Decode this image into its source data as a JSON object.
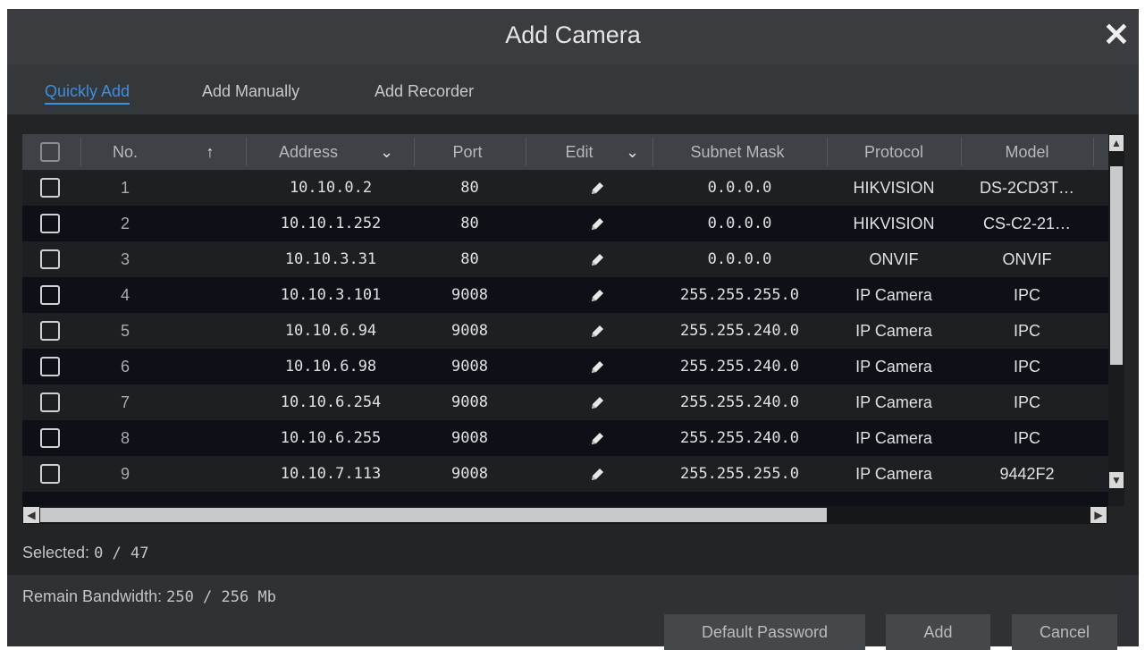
{
  "dialog": {
    "title": "Add Camera"
  },
  "tabs": [
    {
      "label": "Quickly Add",
      "active": true
    },
    {
      "label": "Add Manually",
      "active": false
    },
    {
      "label": "Add Recorder",
      "active": false
    }
  ],
  "table": {
    "headers": {
      "no": "No.",
      "address": "Address",
      "port": "Port",
      "edit": "Edit",
      "subnet": "Subnet Mask",
      "protocol": "Protocol",
      "model": "Model"
    },
    "rows": [
      {
        "no": "1",
        "address": "10.10.0.2",
        "port": "80",
        "subnet": "0.0.0.0",
        "protocol": "HIKVISION",
        "model": "DS-2CD3T…"
      },
      {
        "no": "2",
        "address": "10.10.1.252",
        "port": "80",
        "subnet": "0.0.0.0",
        "protocol": "HIKVISION",
        "model": "CS-C2-21…"
      },
      {
        "no": "3",
        "address": "10.10.3.31",
        "port": "80",
        "subnet": "0.0.0.0",
        "protocol": "ONVIF",
        "model": "ONVIF"
      },
      {
        "no": "4",
        "address": "10.10.3.101",
        "port": "9008",
        "subnet": "255.255.255.0",
        "protocol": "IP Camera",
        "model": "IPC"
      },
      {
        "no": "5",
        "address": "10.10.6.94",
        "port": "9008",
        "subnet": "255.255.240.0",
        "protocol": "IP Camera",
        "model": "IPC"
      },
      {
        "no": "6",
        "address": "10.10.6.98",
        "port": "9008",
        "subnet": "255.255.240.0",
        "protocol": "IP Camera",
        "model": "IPC"
      },
      {
        "no": "7",
        "address": "10.10.6.254",
        "port": "9008",
        "subnet": "255.255.240.0",
        "protocol": "IP Camera",
        "model": "IPC"
      },
      {
        "no": "8",
        "address": "10.10.6.255",
        "port": "9008",
        "subnet": "255.255.240.0",
        "protocol": "IP Camera",
        "model": "IPC"
      },
      {
        "no": "9",
        "address": "10.10.7.113",
        "port": "9008",
        "subnet": "255.255.255.0",
        "protocol": "IP Camera",
        "model": "9442F2"
      }
    ]
  },
  "status": {
    "selected_label": "Selected:",
    "selected_value": "0 / 47",
    "bandwidth_label": "Remain Bandwidth:",
    "bandwidth_value": "250 / 256 Mb"
  },
  "buttons": {
    "default_password": "Default Password",
    "add": "Add",
    "cancel": "Cancel"
  },
  "icons": {
    "close": "close-icon",
    "sort": "sort-arrow-up-icon",
    "edit": "pencil-icon",
    "dropdown": "chevron-down-icon"
  },
  "colors": {
    "accent": "#3d8ede"
  }
}
